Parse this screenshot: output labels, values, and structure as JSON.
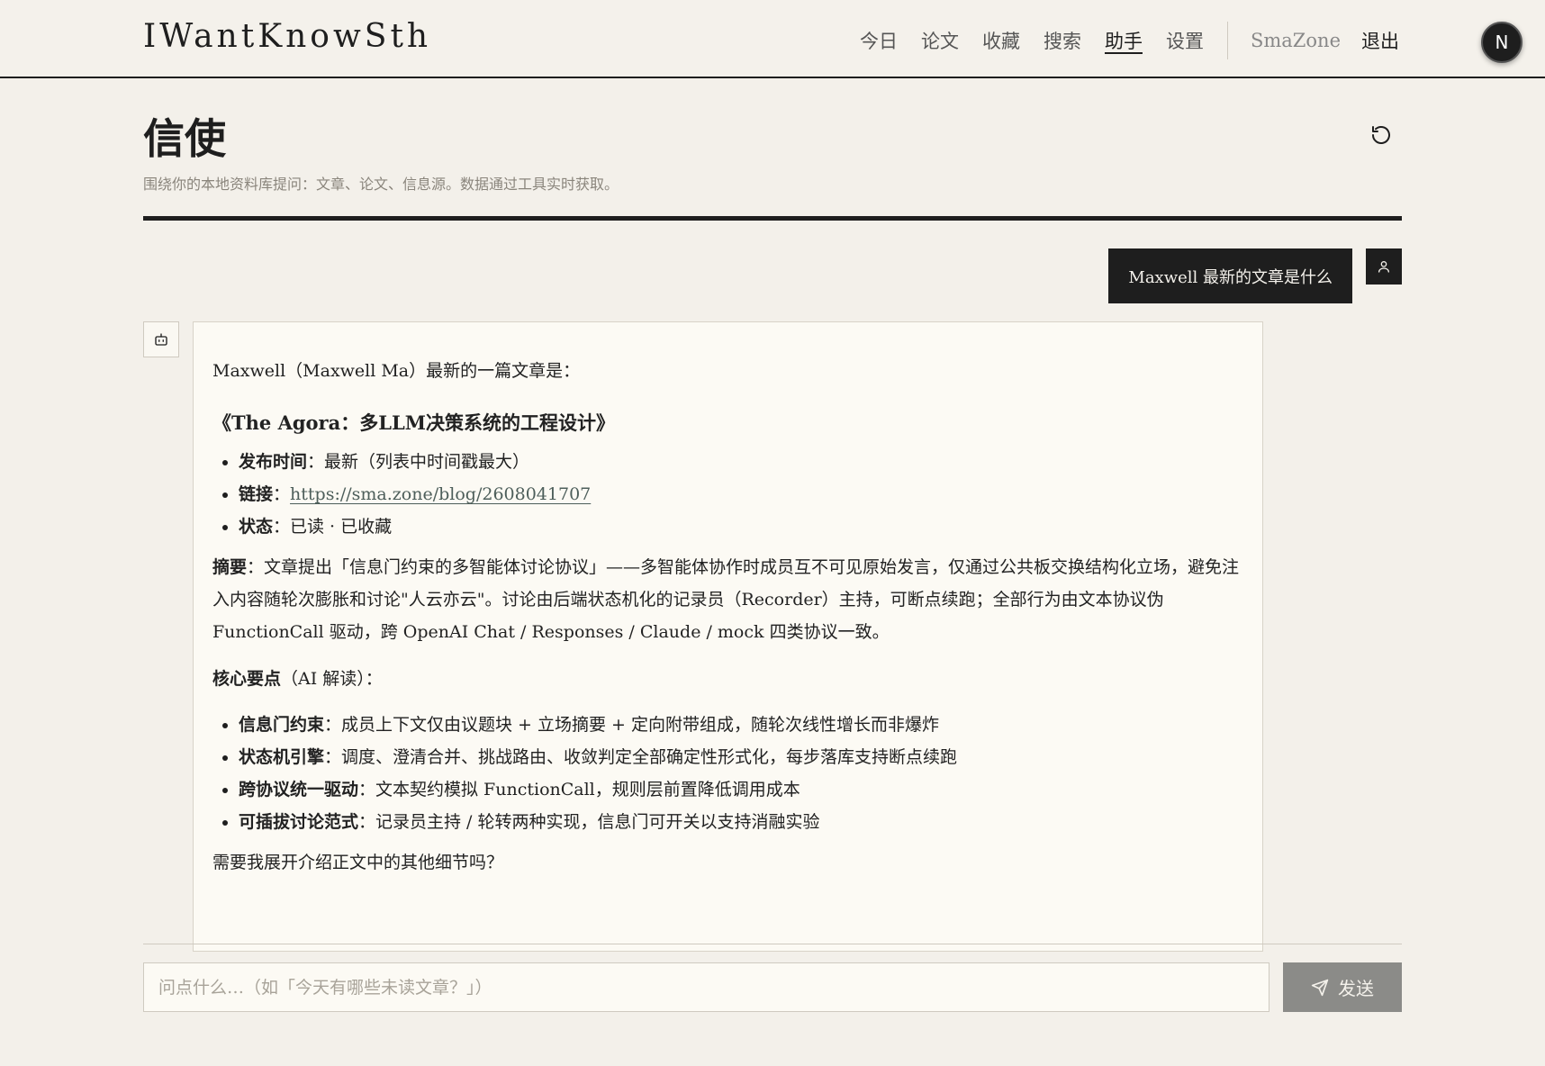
{
  "header": {
    "brand": "IWantKnowSth",
    "nav": [
      {
        "label": "今日",
        "active": false
      },
      {
        "label": "论文",
        "active": false
      },
      {
        "label": "收藏",
        "active": false
      },
      {
        "label": "搜索",
        "active": false
      },
      {
        "label": "助手",
        "active": true
      },
      {
        "label": "设置",
        "active": false
      }
    ],
    "user": "SmaZone",
    "logout": "退出",
    "avatar_letter": "N"
  },
  "page": {
    "title": "信使",
    "subtitle": "围绕你的本地资料库提问：文章、论文、信息源。数据通过工具实时获取。"
  },
  "chat": {
    "user_message": "Maxwell 最新的文章是什么",
    "bot": {
      "intro": "Maxwell（Maxwell Ma）最新的一篇文章是：",
      "article_title": "《The Agora：多LLM决策系统的工程设计》",
      "meta": [
        {
          "label": "发布时间",
          "value": "：最新（列表中时间戳最大）"
        },
        {
          "label": "链接",
          "value": "：",
          "link": "https://sma.zone/blog/2608041707"
        },
        {
          "label": "状态",
          "value": "：已读 · 已收藏"
        }
      ],
      "summary_label": "摘要",
      "summary_text": "：文章提出「信息门约束的多智能体讨论协议」——多智能体协作时成员互不可见原始发言，仅通过公共板交换结构化立场，避免注入内容随轮次膨胀和讨论\"人云亦云\"。讨论由后端状态机化的记录员（Recorder）主持，可断点续跑；全部行为由文本协议伪 FunctionCall 驱动，跨 OpenAI Chat / Responses / Claude / mock 四类协议一致。",
      "key_points_heading": "核心要点",
      "key_points_suffix": "（AI 解读）：",
      "key_points": [
        {
          "label": "信息门约束",
          "value": "：成员上下文仅由议题块 + 立场摘要 + 定向附带组成，随轮次线性增长而非爆炸"
        },
        {
          "label": "状态机引擎",
          "value": "：调度、澄清合并、挑战路由、收敛判定全部确定性形式化，每步落库支持断点续跑"
        },
        {
          "label": "跨协议统一驱动",
          "value": "：文本契约模拟 FunctionCall，规则层前置降低调用成本"
        },
        {
          "label": "可插拔讨论范式",
          "value": "：记录员主持 / 轮转两种实现，信息门可开关以支持消融实验"
        }
      ],
      "closing": "需要我展开介绍正文中的其他细节吗？"
    }
  },
  "composer": {
    "placeholder": "问点什么…（如「今天有哪些未读文章？」）",
    "send_label": "发送"
  }
}
